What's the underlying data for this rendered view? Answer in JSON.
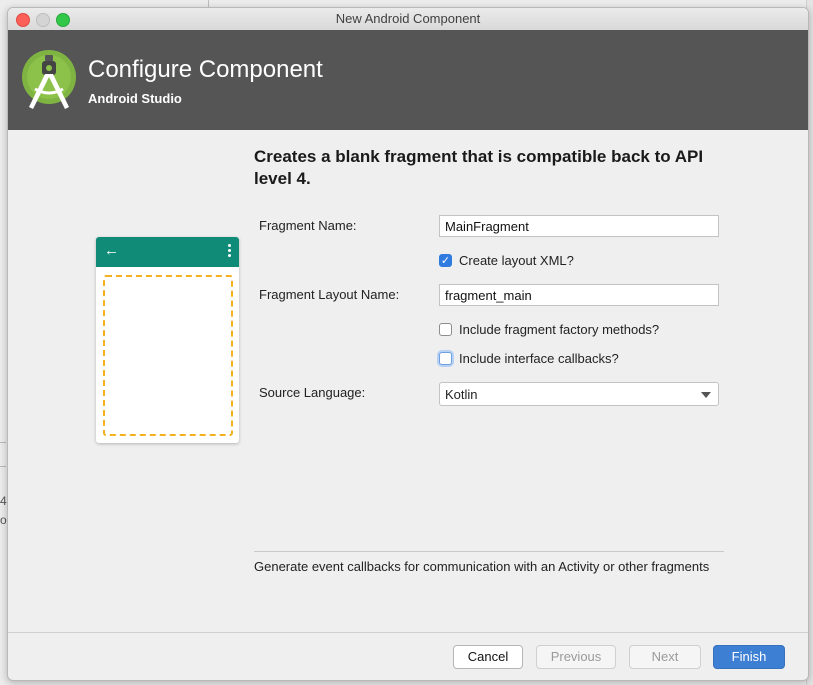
{
  "window": {
    "title": "New Android Component"
  },
  "header": {
    "title": "Configure Component",
    "subtitle": "Android Studio",
    "logo_icon": "android-studio-logo",
    "background_color": "#555555"
  },
  "heading": "Creates a blank fragment that is compatible back to API level 4.",
  "preview": {
    "back_icon": "arrow-back-icon",
    "menu_icon": "overflow-menu-icon",
    "toolbar_color": "#0f8b78",
    "placeholder_border_color": "#f3b01f"
  },
  "form": {
    "fragment_name_label": "Fragment Name:",
    "fragment_name_value": "MainFragment",
    "create_layout_label": "Create layout XML?",
    "create_layout_checked": true,
    "layout_name_label": "Fragment Layout Name:",
    "layout_name_value": "fragment_main",
    "factory_methods_label": "Include fragment factory methods?",
    "factory_methods_checked": false,
    "interface_callbacks_label": "Include interface callbacks?",
    "interface_callbacks_checked": false,
    "source_language_label": "Source Language:",
    "source_language_value": "Kotlin"
  },
  "description": "Generate event callbacks for communication with an Activity or other fragments",
  "footer": {
    "cancel_label": "Cancel",
    "previous_label": "Previous",
    "next_label": "Next",
    "finish_label": "Finish",
    "accent_color": "#3d7fd3"
  },
  "background": {
    "char_1": "4",
    "char_2": "o"
  }
}
